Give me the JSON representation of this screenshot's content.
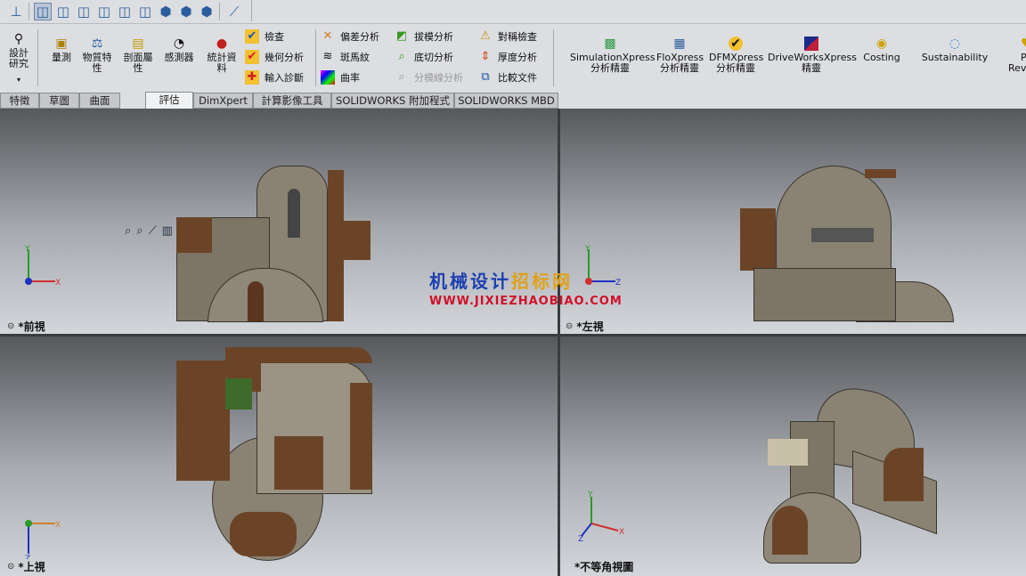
{
  "toolbar": {
    "icons": [
      "normal-to-icon",
      "isometric-view-icon",
      "front-view-icon",
      "back-view-icon",
      "left-view-icon",
      "right-view-icon",
      "top-view-icon",
      "bottom-view-icon",
      "trimetric-view-icon",
      "dimetric-view-icon",
      "view-selector-icon"
    ]
  },
  "ribbon": {
    "design_study": "設計研究",
    "large": [
      {
        "label": "量測",
        "icon": "measure-icon"
      },
      {
        "label": "物質特性",
        "icon": "mass-properties-icon"
      },
      {
        "label": "剖面屬性",
        "icon": "section-properties-icon"
      },
      {
        "label": "感測器",
        "icon": "sensor-icon"
      },
      {
        "label": "統計資料",
        "icon": "statistics-icon"
      }
    ],
    "col1": [
      "檢查",
      "幾何分析",
      "輸入診斷"
    ],
    "col2": [
      "偏差分析",
      "斑馬紋",
      "曲率"
    ],
    "col3": [
      "拔模分析",
      "底切分析",
      "分模線分析"
    ],
    "col4": [
      "對稱檢查",
      "厚度分析",
      "比較文件"
    ],
    "xpress": [
      {
        "line1": "SimulationXpress",
        "line2": "分析精靈"
      },
      {
        "line1": "FloXpress",
        "line2": "分析精靈"
      },
      {
        "line1": "DFMXpress",
        "line2": "分析精靈"
      },
      {
        "line1": "DriveWorksXpress",
        "line2": "精靈"
      },
      {
        "line1": "Costing",
        "line2": ""
      },
      {
        "line1": "Sustainability",
        "line2": ""
      },
      {
        "line1": "P",
        "line2": "Revi"
      }
    ]
  },
  "tabs": [
    "特徵",
    "草圖",
    "曲面",
    "評估",
    "DimXpert",
    "計算影像工具",
    "SOLIDWORKS 附加程式",
    "SOLIDWORKS MBD"
  ],
  "active_tab": "評估",
  "viewports": {
    "front": "*前視",
    "left": "*左視",
    "top": "*上視",
    "iso": "*不等角視圖"
  },
  "watermark": {
    "line1a": "机械设计",
    "line1b": "招标网",
    "line2": "WWW.JIXIEZHAOBIAO.COM"
  },
  "axes": {
    "x": "X",
    "y": "Y",
    "z": "Z"
  },
  "colors": {
    "accent": "#2a5d9c",
    "wood": "#6b4428",
    "wall": "#8a8273",
    "green": "#3f6b2a"
  }
}
